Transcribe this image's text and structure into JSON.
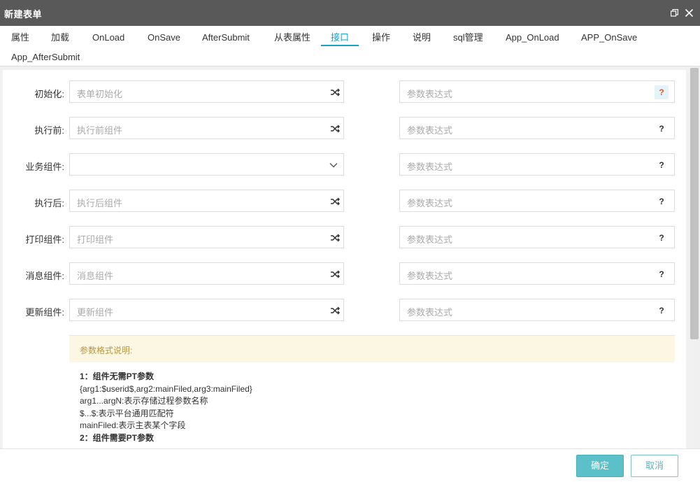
{
  "window": {
    "title": "新建表单"
  },
  "tabs": [
    {
      "label": "属性"
    },
    {
      "label": "加载"
    },
    {
      "label": "OnLoad"
    },
    {
      "label": "OnSave"
    },
    {
      "label": "AfterSubmit"
    },
    {
      "label": "从表属性"
    },
    {
      "label": "接口",
      "active": true
    },
    {
      "label": "操作"
    },
    {
      "label": "说明"
    },
    {
      "label": "sql管理"
    },
    {
      "label": "App_OnLoad"
    },
    {
      "label": "APP_OnSave"
    },
    {
      "label": "App_AfterSubmit"
    }
  ],
  "rows": [
    {
      "label": "初始化:",
      "placeholder": "表单初始化",
      "param_placeholder": "参数表达式",
      "help": "?"
    },
    {
      "label": "执行前:",
      "placeholder": "执行前组件",
      "param_placeholder": "参数表达式",
      "help": "?"
    },
    {
      "label": "业务组件:",
      "placeholder": "",
      "param_placeholder": "参数表达式",
      "help": "?"
    },
    {
      "label": "执行后:",
      "placeholder": "执行后组件",
      "param_placeholder": "参数表达式",
      "help": "?"
    },
    {
      "label": "打印组件:",
      "placeholder": "打印组件",
      "param_placeholder": "参数表达式",
      "help": "?"
    },
    {
      "label": "消息组件:",
      "placeholder": "消息组件",
      "param_placeholder": "参数表达式",
      "help": "?"
    },
    {
      "label": "更新组件:",
      "placeholder": "更新组件",
      "param_placeholder": "参数表达式",
      "help": "?"
    }
  ],
  "tip": {
    "title": "参数格式说明:"
  },
  "notes": [
    {
      "text": "1：组件无需PT参数",
      "bold": true
    },
    {
      "text": "{arg1:$userid$,arg2:mainFiled,arg3:mainFiled}",
      "bold": false
    },
    {
      "text": "arg1...argN:表示存储过程参数名称",
      "bold": false
    },
    {
      "text": "$...$:表示平台通用匹配符",
      "bold": false
    },
    {
      "text": "mainFiled:表示主表某个字段",
      "bold": false
    },
    {
      "text": "2：组件需要PT参数",
      "bold": true
    }
  ],
  "footer": {
    "ok_label": "确定",
    "cancel_label": "取消"
  },
  "colors": {
    "accent": "#1ba0c6",
    "ok_button": "#5bc0c8",
    "titlebar": "#595959",
    "tip_bg": "#fcf7e2"
  }
}
